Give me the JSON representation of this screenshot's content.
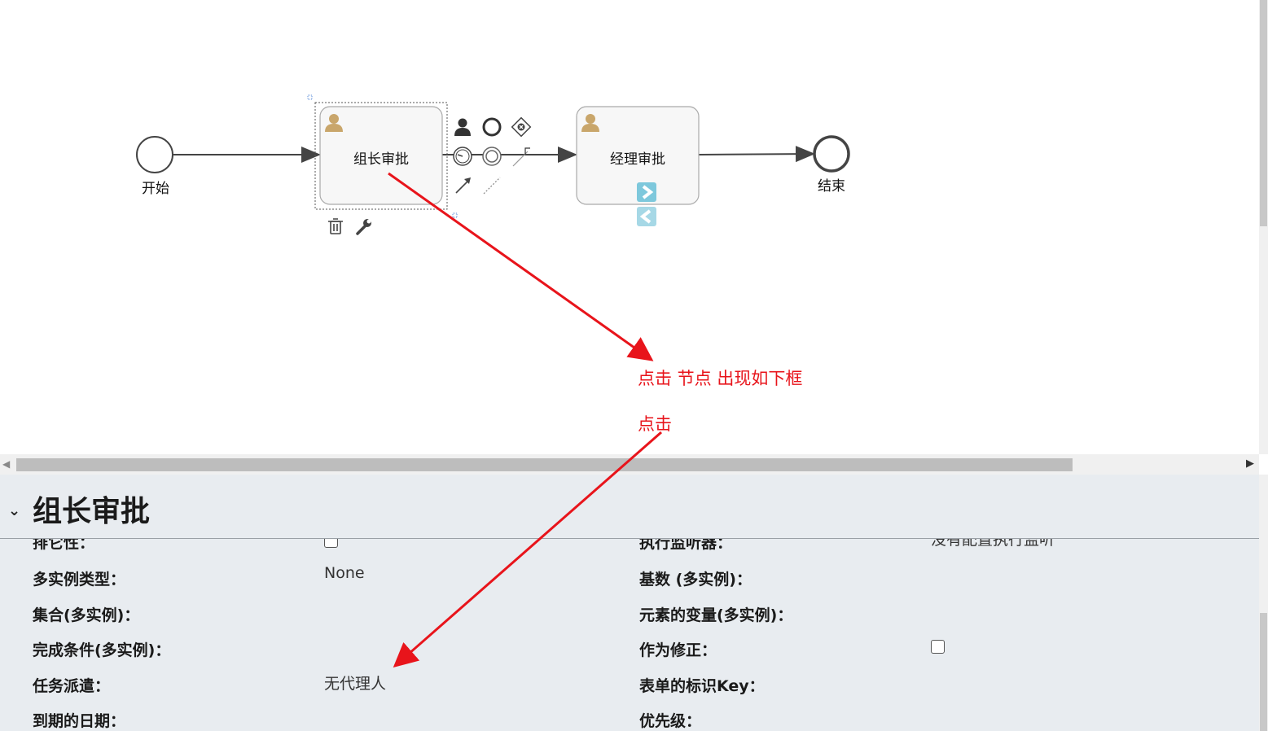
{
  "diagram": {
    "start_label": "开始",
    "task1_label": "组长审批",
    "task2_label": "经理审批",
    "end_label": "结束"
  },
  "annotations": {
    "note1": "点击 节点 出现如下框",
    "note2": "点击"
  },
  "panel": {
    "title": "组长审批",
    "rows": [
      {
        "label": "排它性：",
        "value": "",
        "checkbox": true,
        "label2": "执行监听器：",
        "value2": "没有配置执行监听"
      },
      {
        "label": "多实例类型：",
        "value": "None",
        "label2": "基数 (多实例)：",
        "value2": ""
      },
      {
        "label": "集合(多实例)：",
        "value": "",
        "label2": "元素的变量(多实例)：",
        "value2": ""
      },
      {
        "label": "完成条件(多实例)：",
        "value": "",
        "label2": "作为修正：",
        "checkbox2": true
      },
      {
        "label": "任务派遣：",
        "value": "无代理人",
        "label2": "表单的标识Key：",
        "value2": ""
      },
      {
        "label": "到期的日期：",
        "value": "",
        "label2": "优先级：",
        "value2": ""
      }
    ]
  },
  "colors": {
    "annotation": "#e8141b",
    "panel_bg": "#e8ecf0",
    "task_bg": "#f7f7f7",
    "user_icon": "#c9a66b",
    "arrow_nav": "#7ec8dc"
  }
}
